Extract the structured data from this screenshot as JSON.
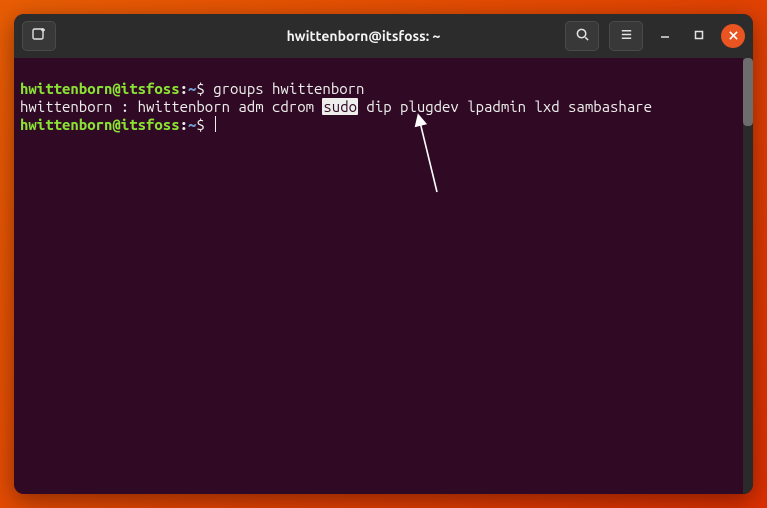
{
  "window": {
    "title": "hwittenborn@itsfoss: ~"
  },
  "titlebar": {
    "new_tab_icon": "new-tab-icon",
    "search_icon": "search-icon",
    "menu_icon": "hamburger-icon",
    "minimize_icon": "minimize-icon",
    "maximize_icon": "maximize-icon",
    "close_icon": "close-icon"
  },
  "terminal": {
    "lines": [
      {
        "prompt_user": "hwittenborn@itsfoss",
        "prompt_colon": ":",
        "prompt_path": "~",
        "prompt_dollar": "$",
        "command": "groups hwittenborn"
      },
      {
        "output_pre": "hwittenborn : hwittenborn adm cdrom ",
        "output_hl": "sudo",
        "output_post": " dip plugdev lpadmin lxd sambashare"
      },
      {
        "prompt_user": "hwittenborn@itsfoss",
        "prompt_colon": ":",
        "prompt_path": "~",
        "prompt_dollar": "$",
        "command": ""
      }
    ]
  },
  "colors": {
    "bg": "#300a24",
    "fg": "#eeeeec",
    "green": "#8ae234",
    "blue": "#729fcf",
    "accent": "#e95420"
  }
}
